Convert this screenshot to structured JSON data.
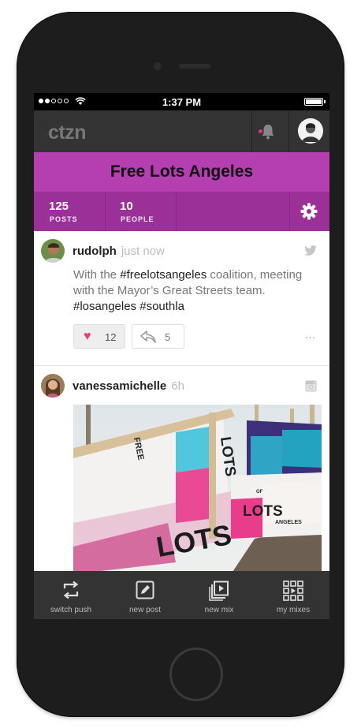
{
  "status": {
    "time": "1:37 PM"
  },
  "app": {
    "logo": "ctzn",
    "avatar_icon": "user-avatar"
  },
  "group": {
    "title": "Free Lots Angeles",
    "stats": [
      {
        "value": "125",
        "label": "POSTS"
      },
      {
        "value": "10",
        "label": "PEOPLE"
      }
    ]
  },
  "posts": [
    {
      "user": "rudolph",
      "time": "just now",
      "source_icon": "twitter-icon",
      "text_parts": [
        "With the ",
        "#freelotsangeles",
        " coalition, meeting with the Mayor’s Great Streets team. ",
        "#losangeles",
        " ",
        "#southla"
      ],
      "likes": "12",
      "replies": "5",
      "more": "..."
    },
    {
      "user": "vanessamichelle",
      "time": "6h",
      "source_icon": "instagram-icon",
      "photo_labels": [
        "FREE",
        "LOTS",
        "LOTS",
        "LOTS",
        "ANGELES",
        "OF"
      ]
    }
  ],
  "tabs": [
    {
      "label": "switch push",
      "icon": "switch-icon"
    },
    {
      "label": "new post",
      "icon": "pencil-icon"
    },
    {
      "label": "new mix",
      "icon": "media-stack-icon"
    },
    {
      "label": "my mixes",
      "icon": "grid-play-icon"
    }
  ],
  "colors": {
    "accent": "#b53eb0",
    "accent_dark": "#9c3099",
    "heart": "#ea3d81",
    "bar": "#333333"
  }
}
